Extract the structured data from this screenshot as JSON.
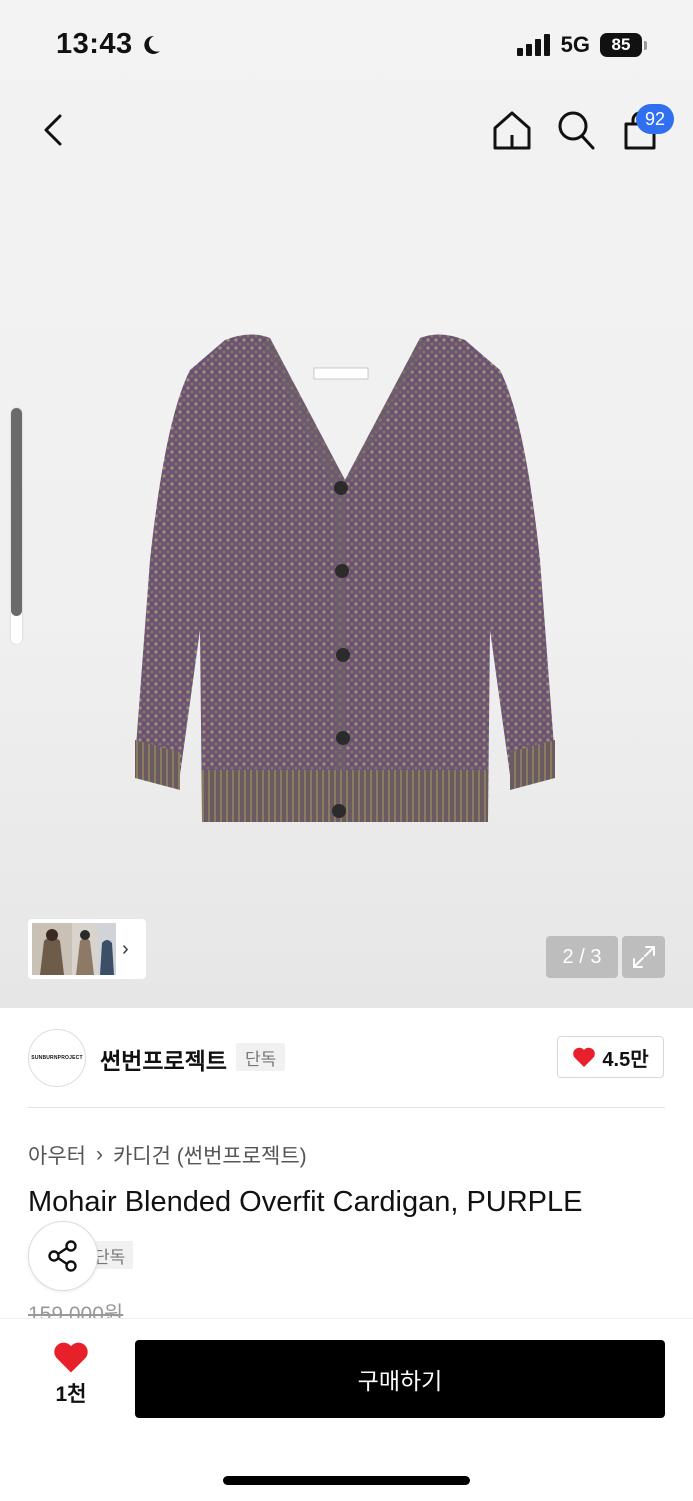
{
  "status_bar": {
    "time": "13:43",
    "network": "5G",
    "battery": "85"
  },
  "nav": {
    "cart_count": "92"
  },
  "gallery": {
    "counter": "2 / 3",
    "product_color": "purple"
  },
  "brand": {
    "logo_text": "SUNBURNPROJECT",
    "name": "썬번프로젝트",
    "tag": "단독",
    "like_count": "4.5만"
  },
  "product": {
    "breadcrumb_parent": "아우터",
    "breadcrumb_child": "카디건 (썬번프로젝트)",
    "title": "Mohair Blended Overfit Cardigan, PURPLE",
    "tag": "단독",
    "original_price": "159,000원"
  },
  "bottom": {
    "like_count": "1천",
    "buy_label": "구매하기"
  },
  "colors": {
    "accent_blue": "#2f6ff0",
    "heart_red": "#e8202a"
  }
}
